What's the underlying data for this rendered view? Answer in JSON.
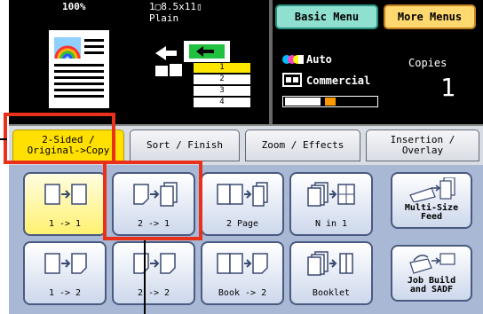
{
  "status": {
    "zoom": "100%",
    "paper_size": "1▢8.5x11▯",
    "paper_type": "Plain",
    "color_mode": "Auto",
    "copies_label": "Copies",
    "copies_count": "1",
    "image_mode": "Commercial",
    "density_level": 0.45,
    "trays": [
      "1",
      "2",
      "3",
      "4"
    ],
    "selected_tray": "1"
  },
  "menu_buttons": {
    "basic": "Basic Menu",
    "more": "More Menus"
  },
  "tabs": [
    {
      "label": "2-Sided /\nOriginal->Copy",
      "active": true
    },
    {
      "label": "Sort / Finish",
      "active": false
    },
    {
      "label": "Zoom / Effects",
      "active": false
    },
    {
      "label": "Insertion /\nOverlay",
      "active": false
    }
  ],
  "options": [
    {
      "label": "1 -> 1",
      "selected": true
    },
    {
      "label": "2 -> 1",
      "selected": false
    },
    {
      "label": "2 Page",
      "selected": false
    },
    {
      "label": "N in 1",
      "selected": false
    },
    {
      "label": "1 -> 2",
      "selected": false
    },
    {
      "label": "2 -> 2",
      "selected": false
    },
    {
      "label": "Book -> 2",
      "selected": false
    },
    {
      "label": "Booklet",
      "selected": false
    }
  ],
  "side_buttons": [
    {
      "label": "Multi-Size\nFeed"
    },
    {
      "label": "Job Build\nand SADF"
    }
  ],
  "colors": {
    "highlight": "#e8301a",
    "selected": "#ffe000",
    "panel": "#a9b8d4"
  }
}
